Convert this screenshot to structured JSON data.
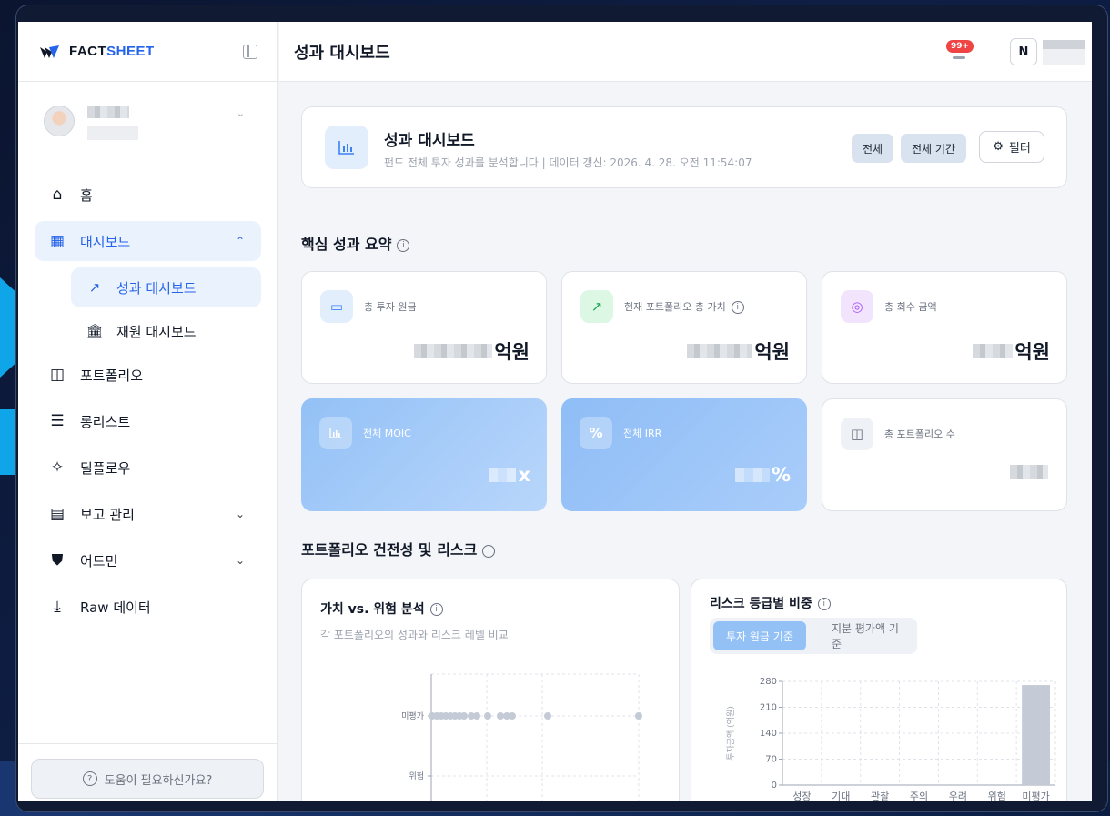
{
  "brand": {
    "name_prefix": "FACT",
    "name_suffix": "SHEET"
  },
  "sidebar": {
    "nav": [
      {
        "label": "홈",
        "icon": "home-icon"
      },
      {
        "label": "대시보드",
        "icon": "dashboard-icon",
        "active": true,
        "expanded": true
      },
      {
        "label": "포트폴리오",
        "icon": "briefcase-icon"
      },
      {
        "label": "롱리스트",
        "icon": "list-icon"
      },
      {
        "label": "딜플로우",
        "icon": "sparkle-icon"
      },
      {
        "label": "보고 관리",
        "icon": "document-icon"
      },
      {
        "label": "어드민",
        "icon": "shield-icon"
      },
      {
        "label": "Raw 데이터",
        "icon": "download-icon"
      }
    ],
    "sub": [
      {
        "label": "성과 대시보드",
        "icon": "trend-icon",
        "active": true
      },
      {
        "label": "재원 대시보드",
        "icon": "bank-icon"
      }
    ],
    "help": "도움이 필요하신가요?"
  },
  "topbar": {
    "title": "성과 대시보드",
    "notif_badge": "99+",
    "brand_logo_letter": "N"
  },
  "header": {
    "title": "성과 대시보드",
    "subtitle": "펀드 전체 투자 성과를 분석합니다 | 데이터 갱신: 2026. 4. 28. 오전 11:54:07",
    "pill_all": "전체",
    "pill_period": "전체 기간",
    "filter": "필터"
  },
  "summary": {
    "title": "핵심 성과 요약",
    "cards": [
      {
        "label": "총 투자 원금",
        "suffix": "억원",
        "icon": "wallet-icon"
      },
      {
        "label": "현재 포트폴리오 총 가치",
        "suffix": "억원",
        "icon": "trend-up-icon"
      },
      {
        "label": "총 회수 금액",
        "suffix": "억원",
        "icon": "piggy-bank-icon"
      },
      {
        "label": "전체 MOIC",
        "suffix": "x",
        "icon": "bar-chart-icon"
      },
      {
        "label": "전체 IRR",
        "suffix": "%",
        "icon": "percent-icon"
      },
      {
        "label": "총 포트폴리오 수",
        "suffix": "",
        "icon": "briefcase-icon"
      }
    ]
  },
  "health": {
    "title": "포트폴리오 건전성 및 리스크",
    "value_risk": {
      "title": "가치 vs. 위험 분석",
      "subtitle": "각 포트폴리오의 성과와 리스크 레벨 비교",
      "y_labels": [
        "미평가",
        "위험"
      ]
    },
    "risk_share": {
      "title": "리스크 등급별 비중",
      "tab_active": "투자 원금 기준",
      "tab_other": "지분 평가액 기준"
    }
  },
  "chart_data": {
    "type": "bar",
    "ylabel": "투자금액 (억원)",
    "categories": [
      "성장",
      "기대",
      "관찰",
      "주의",
      "우려",
      "위험",
      "미평가"
    ],
    "values": [
      0,
      0,
      0,
      0,
      0,
      0,
      270
    ],
    "yticks": [
      0,
      70,
      140,
      210,
      280
    ],
    "ylim": [
      0,
      280
    ],
    "bar_color": "#c4cbd6"
  }
}
